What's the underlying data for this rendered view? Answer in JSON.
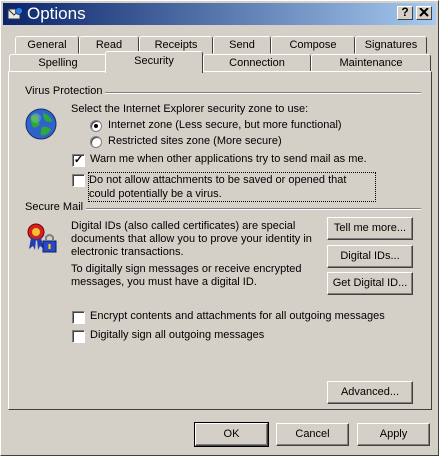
{
  "window": {
    "title": "Options"
  },
  "tabs_back": [
    {
      "label": "General"
    },
    {
      "label": "Read"
    },
    {
      "label": "Receipts"
    },
    {
      "label": "Send"
    },
    {
      "label": "Compose"
    },
    {
      "label": "Signatures"
    }
  ],
  "tabs_front": [
    {
      "label": "Spelling"
    },
    {
      "label": "Security"
    },
    {
      "label": "Connection"
    },
    {
      "label": "Maintenance"
    }
  ],
  "active_tab": "Security",
  "virus": {
    "section_title": "Virus Protection",
    "zone_prompt": "Select the Internet Explorer security zone to use:",
    "radio_internet": "Internet zone (Less secure, but more functional)",
    "radio_restricted": "Restricted sites zone (More secure)",
    "selected_zone": "Internet zone",
    "warn_label": "Warn me when other applications try to send mail as me.",
    "warn_checked": true,
    "attach_label": "Do not allow attachments to be saved or opened that could potentially be a virus.",
    "attach_checked": false
  },
  "secure": {
    "section_title": "Secure Mail",
    "desc1": "Digital IDs (also called certificates) are special documents that allow you to prove your identity in electronic transactions.",
    "desc2": "To digitally sign messages or receive encrypted messages, you must have a digital ID.",
    "tell_more": "Tell me more...",
    "digital_ids": "Digital IDs...",
    "get_digital_id": "Get Digital ID...",
    "encrypt_label": "Encrypt contents and attachments for all outgoing messages",
    "encrypt_checked": false,
    "sign_label": "Digitally sign all outgoing messages",
    "sign_checked": false,
    "advanced": "Advanced..."
  },
  "footer": {
    "ok": "OK",
    "cancel": "Cancel",
    "apply": "Apply"
  }
}
